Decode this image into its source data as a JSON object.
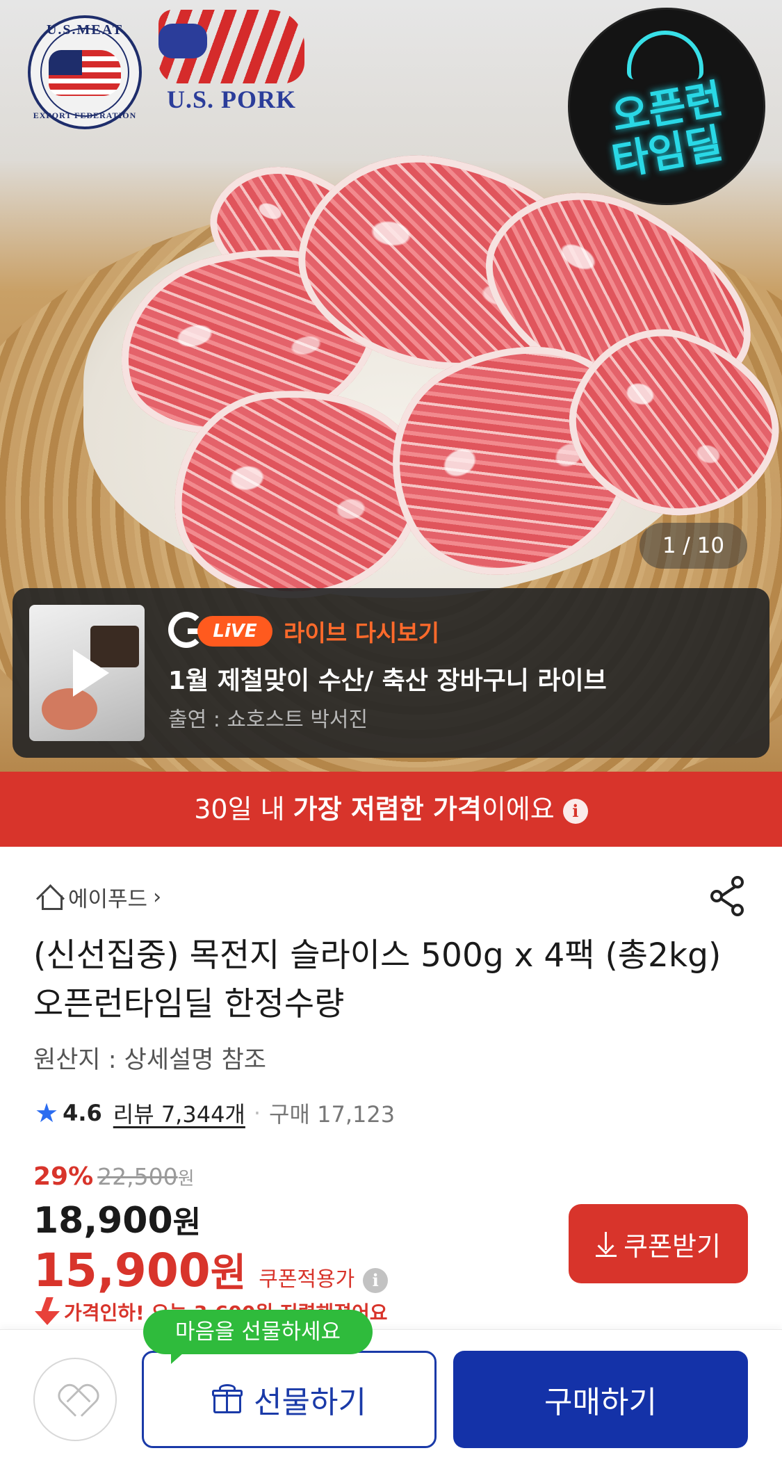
{
  "hero": {
    "image_alt": "sliced pork shoulder in a white bowl",
    "logo_usmef": "U.S.MEAT",
    "logo_usmef_sub": "EXPORT FEDERATION",
    "logo_uspork": "U.S. PORK",
    "opentime_line1": "오픈런",
    "opentime_line2": "타임딜",
    "counter": "1 / 10"
  },
  "live": {
    "badge": "LiVE",
    "replay_label": "라이브 다시보기",
    "title": "1월 제철맞이 수산/ 축산 장바구니 라이브",
    "host": "출연 : 쇼호스트 박서진"
  },
  "price_banner": {
    "prefix": "30일 내 ",
    "emphasis": "가장 저렴한 가격",
    "suffix": "이에요"
  },
  "product": {
    "store_name": "에이푸드",
    "title": "(신선집중) 목전지 슬라이스 500g x 4팩 (총2kg) 오픈런타임딜 한정수량",
    "origin": "원산지 : 상세설명 참조",
    "rating": "4.6",
    "reviews": "리뷰 7,344개",
    "sold": "구매 17,123"
  },
  "price": {
    "discount_pct": "29%",
    "original": "22,500",
    "original_unit": "원",
    "sale": "18,900",
    "sale_unit": "원",
    "coupon_price": "15,900",
    "coupon_unit": "원",
    "coupon_label": "쿠폰적용가",
    "coupon_button": "쿠폰받기",
    "price_drop": "가격인하! 오늘 3,600원 저렴해졌어요"
  },
  "bottom_bar": {
    "tooltip": "마음을 선물하세요",
    "gift_button": "선물하기",
    "buy_button": "구매하기"
  },
  "colors": {
    "accent_red": "#d8342b",
    "brand_blue": "#1432a8",
    "live_orange": "#ff5a1e",
    "tooltip_green": "#2fbb3c"
  },
  "icons": [
    "play-icon",
    "home-icon",
    "chevron-right-icon",
    "share-icon",
    "star-icon",
    "info-icon",
    "download-icon",
    "price-drop-arrow-icon",
    "heart-icon",
    "gift-icon"
  ]
}
